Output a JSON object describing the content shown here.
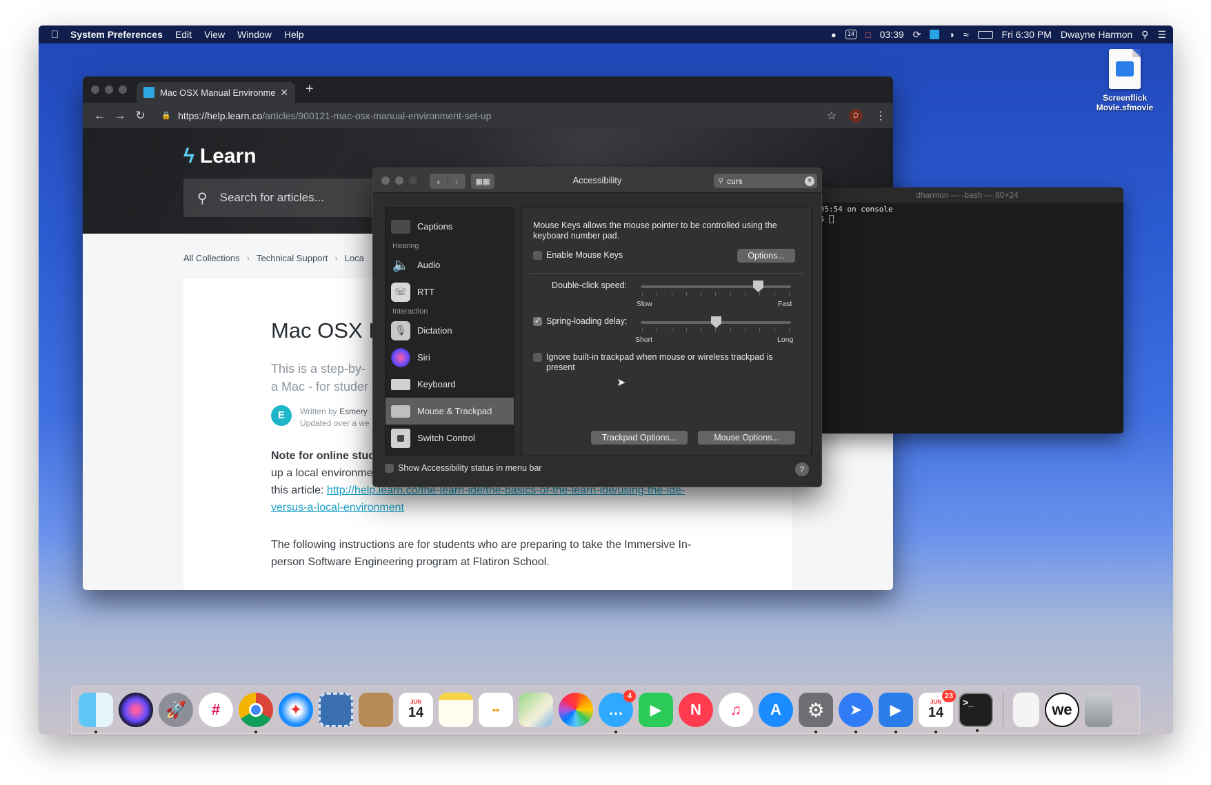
{
  "menubar": {
    "app_name": "System Preferences",
    "menus": [
      "Edit",
      "View",
      "Window",
      "Help"
    ],
    "status": {
      "timer": "03:39",
      "cal_day": "14",
      "datetime": "Fri 6:30 PM",
      "user": "Dwayne Harmon"
    }
  },
  "desktop": {
    "file_label": "Screenflick Movie.sfmovie"
  },
  "browser": {
    "tab_title": "Mac OSX Manual Environment",
    "url_host": "https://help.learn.co",
    "url_path": "/articles/900121-mac-osx-manual-environment-set-up",
    "avatar_letter": "D",
    "logo_text": "Learn",
    "search_placeholder": "Search for articles...",
    "breadcrumbs": [
      "All Collections",
      "Technical Support",
      "Loca"
    ],
    "article": {
      "title": "Mac OSX I",
      "lead_1": "This is a step-by-",
      "lead_2": "a Mac - for studer",
      "author_initial": "E",
      "written_by": "Written by",
      "author": "Esmery",
      "updated": "Updated over a we",
      "note_bold": "Note for online stud",
      "note_line2": "up a local environme",
      "note_line3_prefix": "this article: ",
      "link_line1": "http://help.learn.co/the-learn-ide/the-basics-of-the-learn-ide/using-the-ide-",
      "link_line2": "versus-a-local-environment",
      "para2_line1": "The following instructions are for students who are preparing to take the Immersive In-",
      "para2_line2": "person Software Engineering program at Flatiron School."
    }
  },
  "terminal": {
    "title": "dharmon — -bash — 80×24",
    "line1": ":05:54 on console",
    "line2": "n$ "
  },
  "accessibility": {
    "window_title": "Accessibility",
    "search_value": "curs",
    "sidebar": {
      "captions": "Captions",
      "hearing": "Hearing",
      "audio": "Audio",
      "rtt": "RTT",
      "interaction": "Interaction",
      "dictation": "Dictation",
      "siri": "Siri",
      "keyboard": "Keyboard",
      "mouse_trackpad": "Mouse & Trackpad",
      "switch_control": "Switch Control"
    },
    "selected_item": "Mouse & Trackpad",
    "main": {
      "description": "Mouse Keys allows the mouse pointer to be controlled using the keyboard number pad.",
      "enable_mouse_keys": "Enable Mouse Keys",
      "enable_mouse_keys_checked": false,
      "options_button": "Options...",
      "double_click_label": "Double-click speed:",
      "double_click_value": 0.78,
      "slow": "Slow",
      "fast": "Fast",
      "spring_label": "Spring-loading delay:",
      "spring_checked": true,
      "spring_value": 0.5,
      "short": "Short",
      "long": "Long",
      "ignore_trackpad": "Ignore built-in trackpad when mouse or wireless trackpad is present",
      "ignore_trackpad_checked": false,
      "trackpad_options": "Trackpad Options...",
      "mouse_options": "Mouse Options..."
    },
    "footer_checkbox": "Show Accessibility status in menu bar",
    "help": "?"
  },
  "dock": {
    "cal_month": "JUN",
    "cal_day": "14",
    "messages_badge": "4",
    "calendar2_month": "JUN",
    "calendar2_badge": "23",
    "calendar2_day": "14",
    "we_label": "we"
  }
}
